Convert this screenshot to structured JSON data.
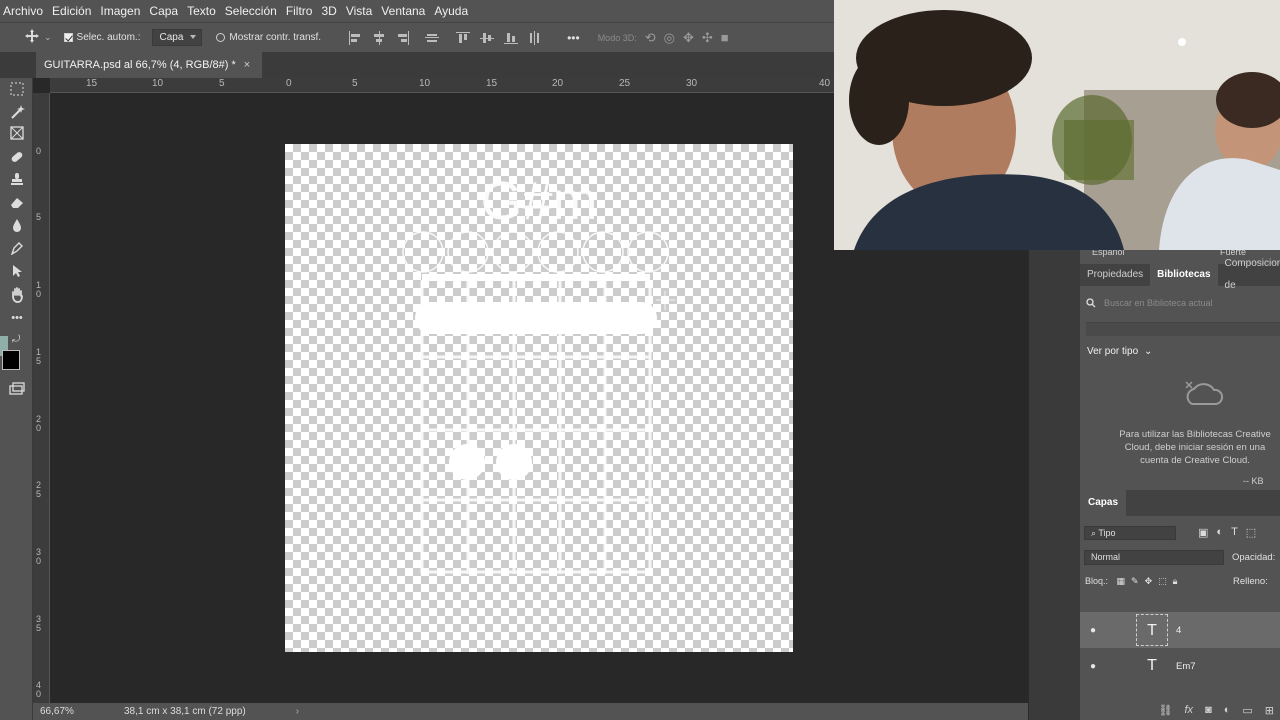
{
  "menu": [
    "Archivo",
    "Edición",
    "Imagen",
    "Capa",
    "Texto",
    "Selección",
    "Filtro",
    "3D",
    "Vista",
    "Ventana",
    "Ayuda"
  ],
  "options": {
    "auto_select_label": "Selec. autom.:",
    "auto_select_target": "Capa",
    "show_transform_label": "Mostrar contr. transf.",
    "more_label": "•••",
    "mode_3d_label": "Modo 3D:"
  },
  "document": {
    "tab_title": "GUITARRA.psd al 66,7% (4, RGB/8#) *",
    "close_glyph": "×",
    "chord_name": "G#m"
  },
  "rulers": {
    "h": [
      "15",
      "10",
      "5",
      "0",
      "5",
      "10",
      "15",
      "20",
      "25",
      "30",
      "40"
    ],
    "v": [
      "0",
      "5",
      "1 0",
      "1 5",
      "2 0",
      "2 5",
      "3 0",
      "3 5",
      "4 0"
    ]
  },
  "status": {
    "zoom": "66,67%",
    "doc_size": "38,1 cm x 38,1 cm (72 ppp)",
    "arrow": "›"
  },
  "panels": {
    "tabs": [
      "Propiedades",
      "Bibliotecas",
      "Composiciones de"
    ],
    "search_placeholder": "Buscar en Biblioteca actual",
    "view_by_type": "Ver por tipo",
    "cc_message": "Para utilizar las Bibliotecas Creative Cloud, debe iniciar sesión en una cuenta de Creative Cloud.",
    "kb": "-- KB",
    "top_left_label": "Español",
    "top_right_label": "Fuerte"
  },
  "layers": {
    "tab": "Capas",
    "filter_type": "Tipo",
    "blend_mode": "Normal",
    "opacity_label": "Opacidad:",
    "lock_label": "Bloq.:",
    "fill_label": "Relleno:",
    "items": [
      {
        "name": "4",
        "selected": true
      },
      {
        "name": "Em7",
        "selected": false
      }
    ]
  },
  "colors": {
    "ui_bg": "#535353",
    "workspace": "#282828",
    "foreground_swatch": "#8fb0a8",
    "background_swatch": "#000000"
  }
}
